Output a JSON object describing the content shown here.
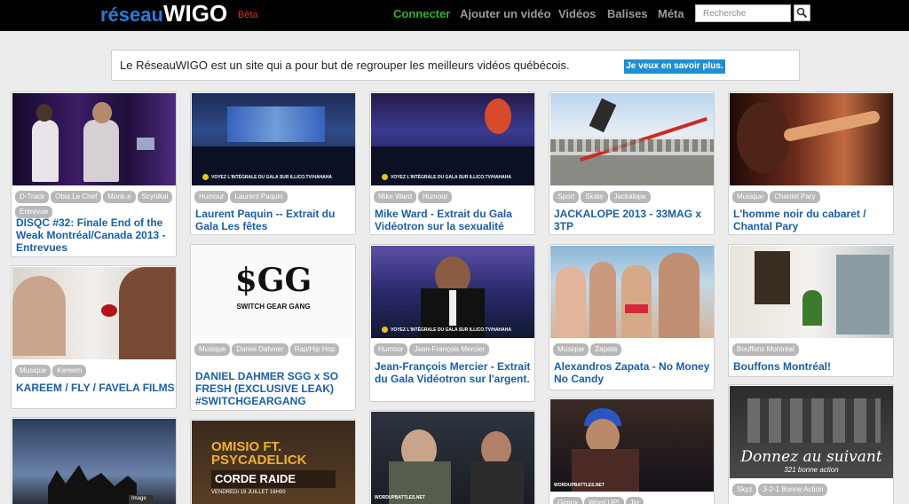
{
  "header": {
    "logo_part1": "réseau",
    "logo_part2": "WIGO",
    "beta": "Bêta",
    "nav": [
      "Connecter",
      "Ajouter un vidéo",
      "Vidéos",
      "Balises",
      "Méta"
    ],
    "search_placeholder": "Recherche"
  },
  "banner": {
    "text": "Le RéseauWIGO est un site qui a pour but de regrouper les meilleurs vidéos québécois.",
    "button": "Je veux en savoir plus."
  },
  "overlays": {
    "gala_ticker": "VOYEZ L'INTÉGRALE DU GALA SUR ILLICO.TV/HAHAHA",
    "sgg_logo": "$GG",
    "sgg_sub": "SWITCH GEAR GANG",
    "omisio_line1": "OMISIO FT.",
    "omisio_line2": "PSYCADELICK",
    "omisio_line3": "CORDE RAIDE",
    "omisio_line4": "VENDREDI 19 JUILLET 16H00",
    "battle_tag": "WORDUPBATTLES.NET",
    "donnez_line1": "Donnez au suivant",
    "donnez_line2": "321 bonne action",
    "image_label": "Image"
  },
  "cards": [
    {
      "tags": [
        "D-Track",
        "Obia Le Chef",
        "Monk.e",
        "Scynikal",
        "Entrevue"
      ],
      "title": "DISQC #32: Finale End of the Weak Montréal/Canada 2013 - Entrevues"
    },
    {
      "tags": [
        "Humour",
        "Laurent Paquin"
      ],
      "title": "Laurent Paquin -- Extrait du Gala Les fêtes"
    },
    {
      "tags": [
        "Mike Ward",
        "Humour"
      ],
      "title": "Mike Ward - Extrait du Gala Vidéotron sur la sexualité"
    },
    {
      "tags": [
        "Sport",
        "Skate",
        "Jackalope"
      ],
      "title": "JACKALOPE 2013 - 33MAG x 3TP"
    },
    {
      "tags": [
        "Musique",
        "Chantel Pary"
      ],
      "title": "L'homme noir du cabaret / Chantal Pary"
    },
    {
      "tags": [
        "Musique",
        "Kereem"
      ],
      "title": "KAREEM / FLY / FAVELA FILMS"
    },
    {
      "tags": [
        "Musique",
        "Daniel Dahmer",
        "Rap/Hip Hop"
      ],
      "title": "DANIEL DAHMER SGG x SO FRESH (EXCLUSIVE LEAK) #SWITCHGEARGANG"
    },
    {
      "tags": [
        "Humour",
        "Jean-François Mercier"
      ],
      "title": "Jean-François Mercier - Extrait du Gala Vidéotron sur l'argent."
    },
    {
      "tags": [
        "Musique",
        "Zapata"
      ],
      "title": "Alexandros Zapata - No Money No Candy"
    },
    {
      "tags": [
        "Bouffons Montréal"
      ],
      "title": "Bouffons Montréal!"
    },
    {
      "tags": [],
      "title": ""
    },
    {
      "tags": [],
      "title": ""
    },
    {
      "tags": [],
      "title": ""
    },
    {
      "tags": [
        "Gimux",
        "Word UP!",
        "Jig"
      ],
      "title": ""
    },
    {
      "tags": [
        "Skyz",
        "3-2-1 Bonne Action"
      ],
      "title": ""
    }
  ]
}
